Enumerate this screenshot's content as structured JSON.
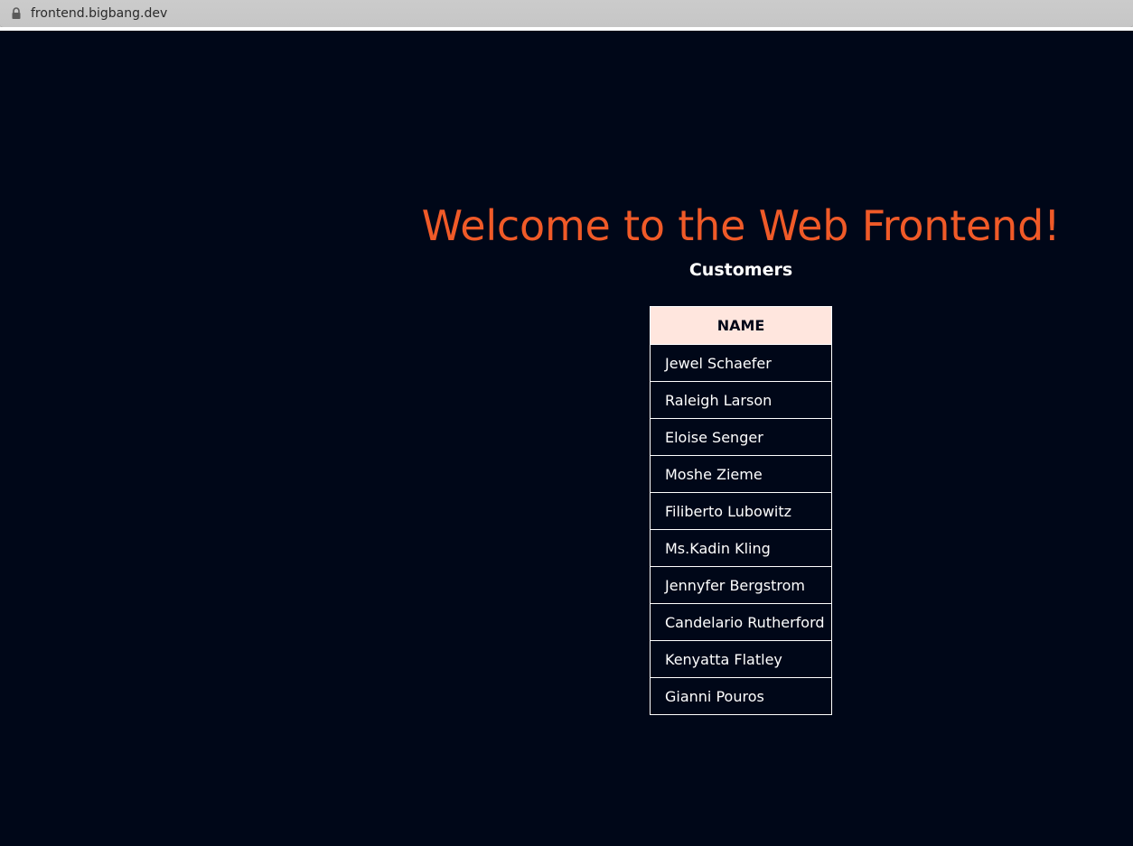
{
  "browser": {
    "url": "frontend.bigbang.dev",
    "lock_icon": "lock-icon"
  },
  "page": {
    "title": "Welcome to the Web Frontend!",
    "section_heading": "Customers",
    "colors": {
      "background": "#000718",
      "title": "#f05a28",
      "header_bg": "#ffe6de",
      "text": "#ffffff"
    }
  },
  "table": {
    "header": "NAME",
    "rows": [
      "Jewel Schaefer",
      "Raleigh Larson",
      "Eloise Senger",
      "Moshe Zieme",
      "Filiberto Lubowitz",
      "Ms.Kadin Kling",
      "Jennyfer Bergstrom",
      "Candelario Rutherford",
      "Kenyatta Flatley",
      "Gianni Pouros"
    ]
  }
}
